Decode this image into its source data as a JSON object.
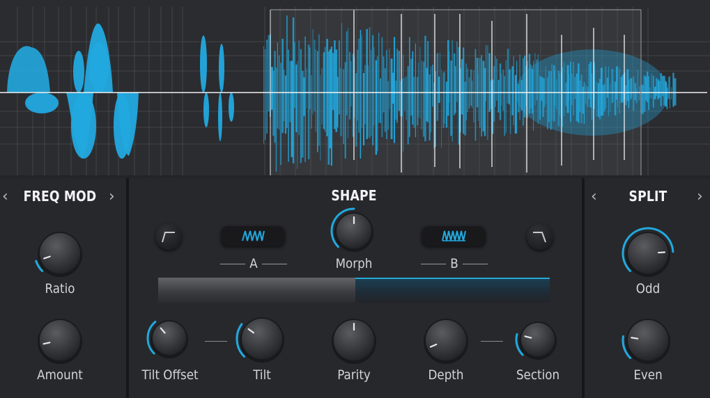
{
  "colors": {
    "accent": "#22a9df",
    "background": "#232427",
    "waveform_bg": "#2b2c30"
  },
  "freq_mod": {
    "title": "FREQ MOD",
    "prev_icon": "chevron-left-icon",
    "next_icon": "chevron-right-icon",
    "knobs": [
      {
        "label": "Ratio",
        "value": 0.1
      },
      {
        "label": "Amount",
        "value": 0.12
      }
    ]
  },
  "shape": {
    "title": "SHAPE",
    "left_icon": "ramp-up-shape-icon",
    "right_icon": "ramp-down-shape-icon",
    "a_label": "A",
    "b_label": "B",
    "a_icon": "triangle-wave-icon",
    "b_icon": "square-wave-icon",
    "morph": {
      "label": "Morph",
      "value": 0.5
    },
    "morph_bar_level": 0.5,
    "knobs": [
      {
        "label": "Tilt Offset",
        "value": 0.35
      },
      {
        "label": "Tilt",
        "value": 0.3
      },
      {
        "label": "Parity",
        "value": 0.5
      },
      {
        "label": "Depth",
        "value": 0.08
      },
      {
        "label": "Section",
        "value": 0.22
      }
    ]
  },
  "split": {
    "title": "SPLIT",
    "prev_icon": "chevron-left-icon",
    "next_icon": "chevron-right-icon",
    "knobs": [
      {
        "label": "Odd",
        "value": 0.82
      },
      {
        "label": "Even",
        "value": 0.2
      }
    ]
  }
}
